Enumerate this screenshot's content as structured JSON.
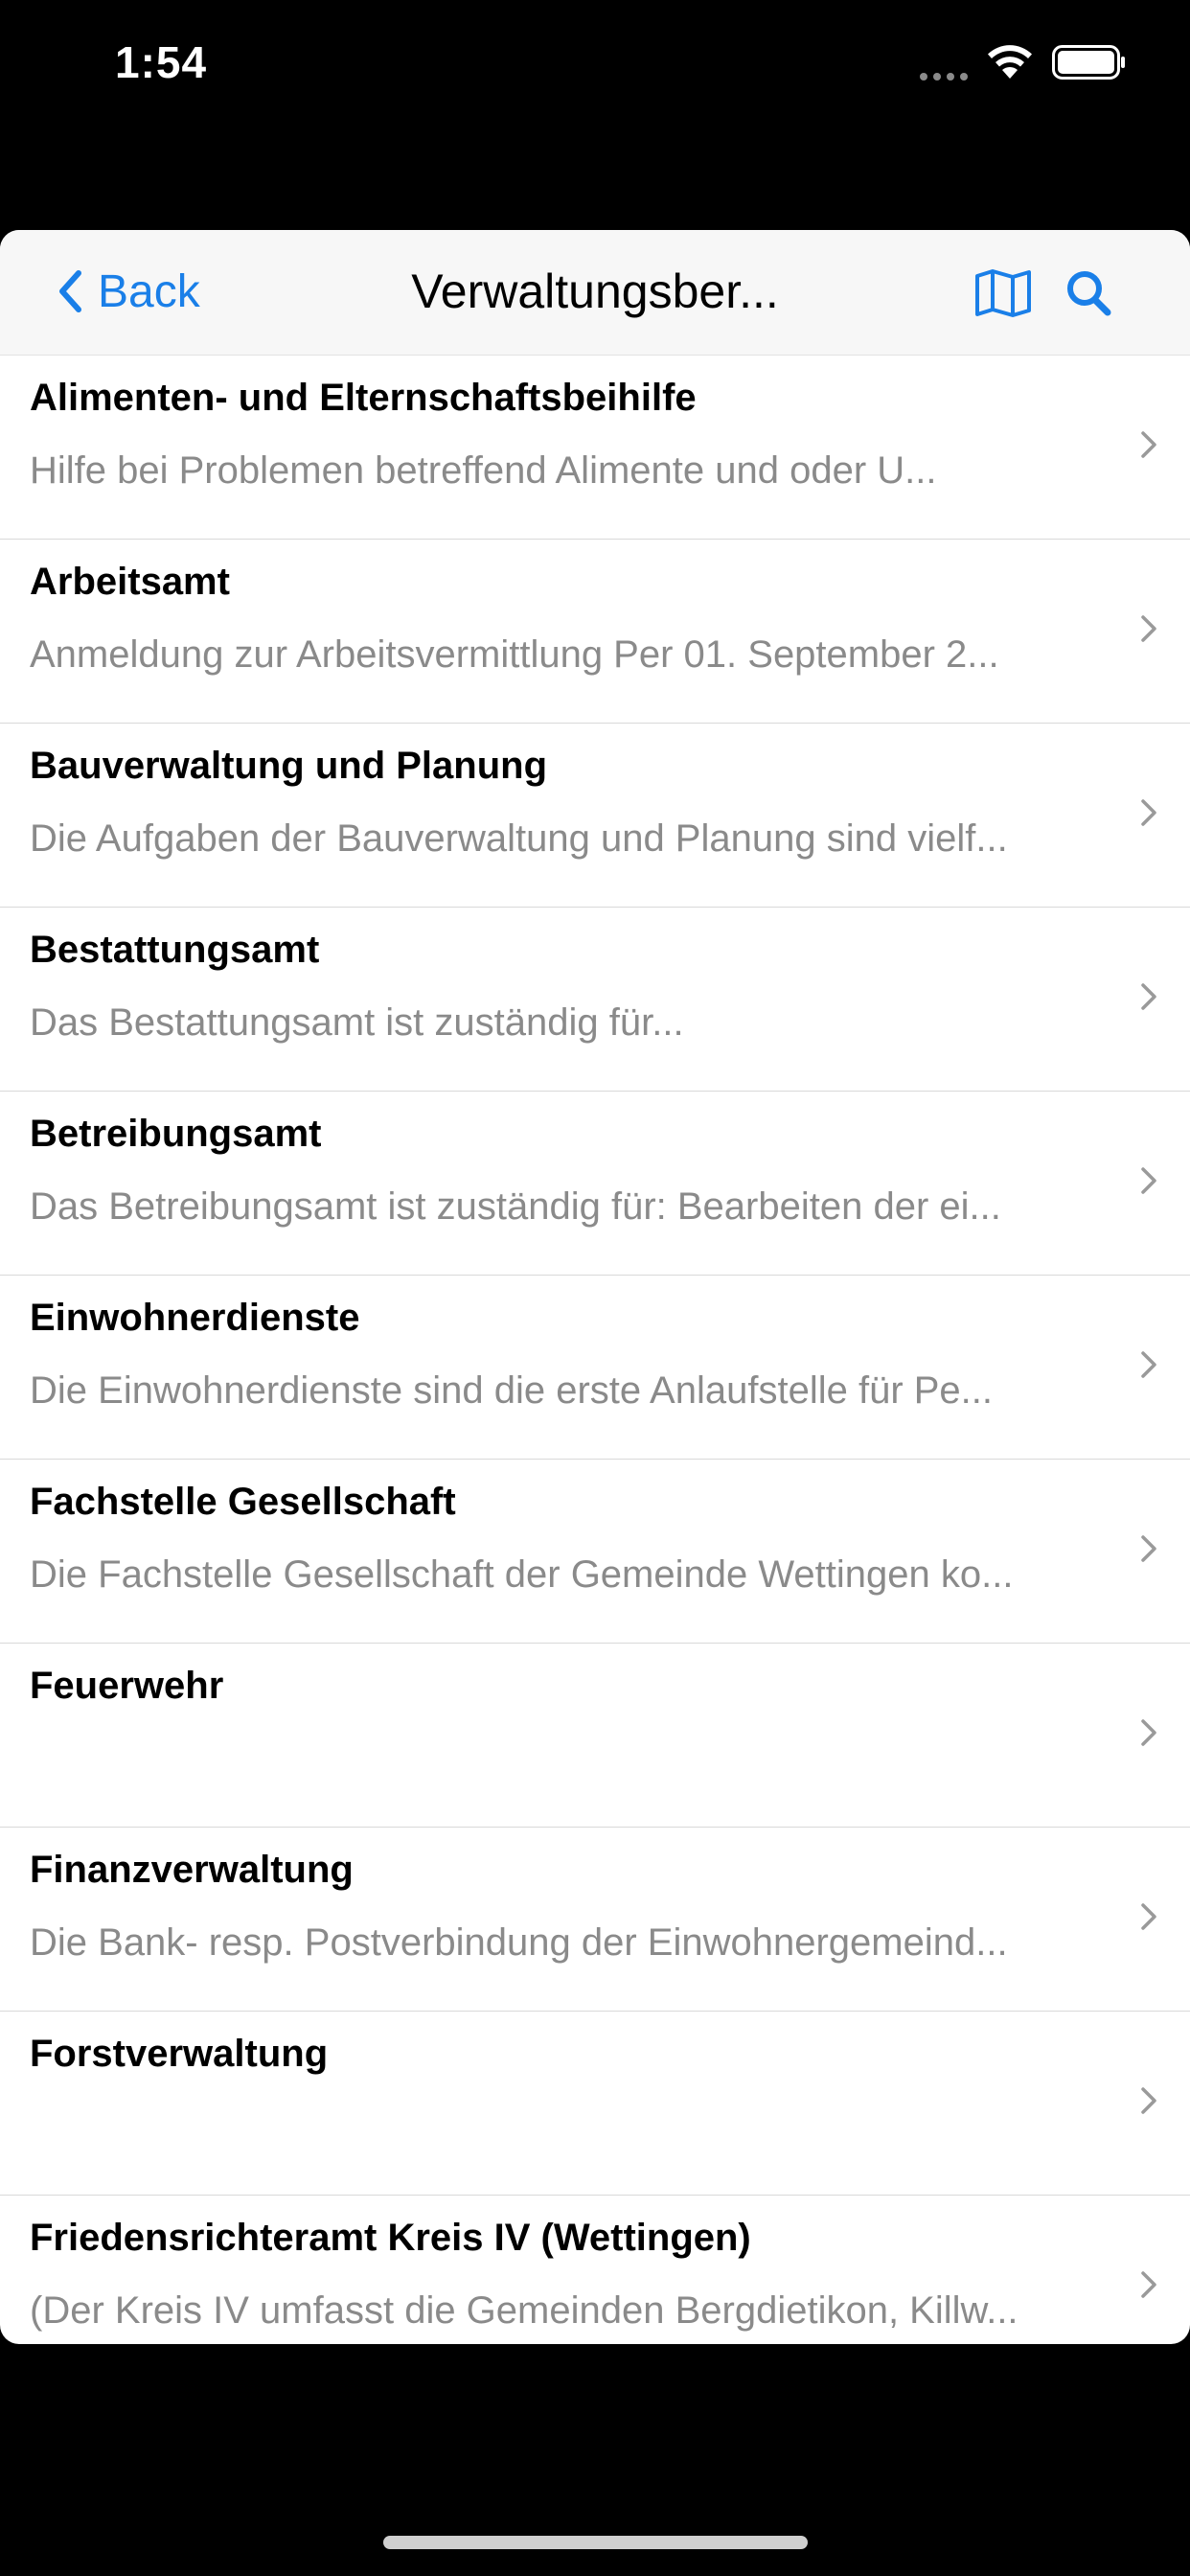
{
  "status_bar": {
    "time": "1:54"
  },
  "nav": {
    "back_label": "Back",
    "title": "Verwaltungsber...",
    "accent_color": "#1a7fe8",
    "icons": [
      "chevron-left-icon",
      "map-icon",
      "search-icon"
    ]
  },
  "items": [
    {
      "title": "Alimenten- und Elternschaftsbeihilfe",
      "subtitle": "Hilfe bei Problemen betreffend Alimente und oder U..."
    },
    {
      "title": "Arbeitsamt",
      "subtitle": "Anmeldung zur Arbeitsvermittlung  Per 01. September 2..."
    },
    {
      "title": "Bauverwaltung und Planung",
      "subtitle": "Die Aufgaben der Bauverwaltung und Planung sind vielf..."
    },
    {
      "title": "Bestattungsamt",
      "subtitle": "Das Bestattungsamt ist zuständig für..."
    },
    {
      "title": "Betreibungsamt",
      "subtitle": "Das Betreibungsamt ist zuständig für:  Bearbeiten der ei..."
    },
    {
      "title": "Einwohnerdienste",
      "subtitle": "Die Einwohnerdienste sind die erste Anlaufstelle für Pe..."
    },
    {
      "title": "Fachstelle Gesellschaft",
      "subtitle": "Die Fachstelle Gesellschaft der Gemeinde Wettingen ko..."
    },
    {
      "title": "Feuerwehr",
      "subtitle": ""
    },
    {
      "title": "Finanzverwaltung",
      "subtitle": "Die Bank- resp. Postverbindung der Einwohnergemeind..."
    },
    {
      "title": "Forstverwaltung",
      "subtitle": ""
    },
    {
      "title": "Friedensrichteramt Kreis IV (Wettingen)",
      "subtitle": "(Der Kreis IV umfasst die Gemeinden Bergdietikon, Killw..."
    }
  ]
}
